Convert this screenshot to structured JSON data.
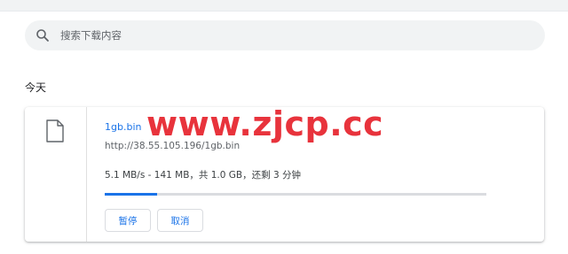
{
  "search": {
    "placeholder": "搜索下载内容",
    "icon": "search-icon"
  },
  "section": {
    "date_label": "今天"
  },
  "download": {
    "file_name": "1gb.bin",
    "url": "http://38.55.105.196/1gb.bin",
    "status": "5.1 MB/s - 141 MB，共 1.0 GB，还剩 3 分钟",
    "progress": 0.138,
    "pause_label": "暂停",
    "cancel_label": "取消",
    "file_icon": "file-icon"
  },
  "watermark": {
    "text": "www.zjcp.cc",
    "color": "#e8333c"
  },
  "colors": {
    "accent": "#1a73e8",
    "track": "#dadce0",
    "search_bg": "#f1f3f4"
  }
}
